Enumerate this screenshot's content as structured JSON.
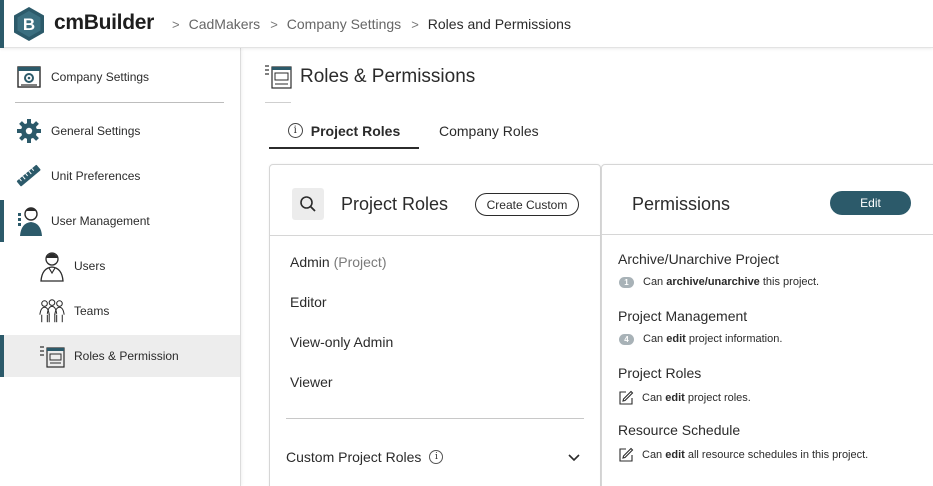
{
  "app": {
    "brand": "cmBuilder",
    "logo_letter": "B"
  },
  "breadcrumb": [
    {
      "label": "CadMakers"
    },
    {
      "label": "Company Settings"
    },
    {
      "label": "Roles and Permissions"
    }
  ],
  "sidebar": {
    "items": [
      {
        "label": "Company Settings",
        "icon": "company-settings-icon"
      },
      {
        "label": "General Settings",
        "icon": "gear-icon"
      },
      {
        "label": "Unit Preferences",
        "icon": "ruler-icon"
      },
      {
        "label": "User Management",
        "icon": "user-management-icon"
      },
      {
        "label": "Users",
        "icon": "user-icon"
      },
      {
        "label": "Teams",
        "icon": "team-icon"
      },
      {
        "label": "Roles & Permission",
        "icon": "roles-permission-icon"
      }
    ]
  },
  "page": {
    "title": "Roles & Permissions"
  },
  "tabs": [
    {
      "label": "Project Roles",
      "active": true
    },
    {
      "label": "Company Roles",
      "active": false
    }
  ],
  "roles_panel": {
    "title": "Project Roles",
    "create_button": "Create Custom",
    "roles": [
      {
        "name": "Admin",
        "suffix": "(Project)"
      },
      {
        "name": "Editor",
        "suffix": ""
      },
      {
        "name": "View-only Admin",
        "suffix": ""
      },
      {
        "name": "Viewer",
        "suffix": ""
      }
    ],
    "custom_section": "Custom Project Roles"
  },
  "permissions_panel": {
    "title": "Permissions",
    "edit_button": "Edit",
    "sections": [
      {
        "heading": "Archive/Unarchive Project",
        "badge": "1",
        "pre": "Can ",
        "bold": "archive/unarchive",
        "post": " this project."
      },
      {
        "heading": "Project Management",
        "badge": "4",
        "pre": "Can ",
        "bold": "edit",
        "post": " project information."
      },
      {
        "heading": "Project Roles",
        "badge": "",
        "pre": "Can ",
        "bold": "edit",
        "post": " project roles."
      },
      {
        "heading": "Resource Schedule",
        "badge": "",
        "pre": "Can ",
        "bold": "edit",
        "post": " all resource schedules in this project."
      }
    ]
  },
  "colors": {
    "accent": "#2c5a6a",
    "badge": "#a8b2b7",
    "active_bg": "#ededed"
  }
}
